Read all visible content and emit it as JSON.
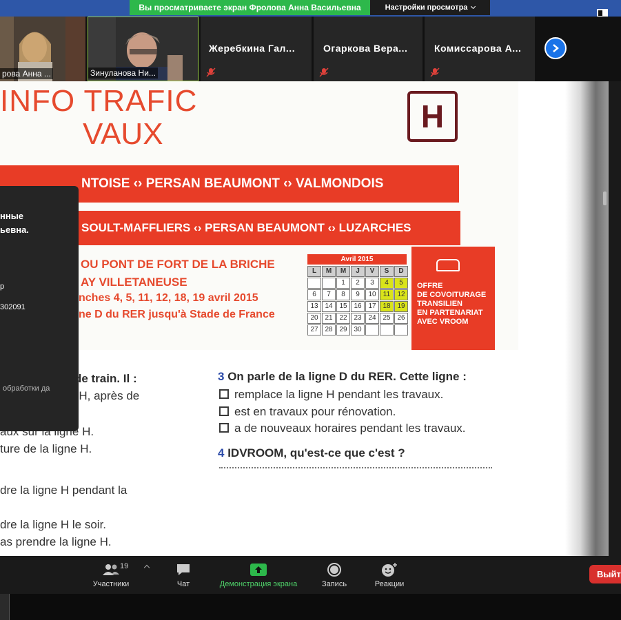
{
  "banner": {
    "sharing_text": "Вы просматриваете экран Фролова Анна Васильевна",
    "view_settings_label": "Настройки просмотра"
  },
  "participants": [
    {
      "label": "рова Анна ..."
    },
    {
      "label": "Зинуланова Ни..."
    },
    {
      "name": "Жеребкина  Гал..."
    },
    {
      "name": "Огаркова  Вера..."
    },
    {
      "name": "Комиссарова  А..."
    }
  ],
  "poster": {
    "title_line1": "INFO TRAFIC",
    "title_line2": "VAUX",
    "line_letter": "H",
    "band1": "NTOISE ‹› PERSAN BEAUMONT ‹› VALMONDOIS",
    "band2": "SOULT-MAFFLIERS ‹› PERSAN BEAUMONT ‹› LUZARCHES",
    "info1": "OU PONT DE FORT DE LA BRICHE",
    "info2": "AY VILLETANEUSE",
    "info3": "nches 4, 5, 11, 12, 18, 19 avril 2015",
    "info4": "ne D du RER jusqu'à Stade de France",
    "offer_lines": [
      "OFFRE",
      "DE COVOITURAGE",
      "TRANSILIEN",
      "EN PARTENARIAT",
      "AVEC  VROOM"
    ],
    "calendar": {
      "title": "Avril 2015",
      "headers": [
        "L",
        "M",
        "M",
        "J",
        "V",
        "S",
        "D"
      ],
      "rows": [
        [
          "",
          "",
          "1",
          "2",
          "3",
          "4",
          "5"
        ],
        [
          "6",
          "7",
          "8",
          "9",
          "10",
          "11",
          "12"
        ],
        [
          "13",
          "14",
          "15",
          "16",
          "17",
          "18",
          "19"
        ],
        [
          "20",
          "21",
          "22",
          "23",
          "24",
          "25",
          "26"
        ],
        [
          "27",
          "28",
          "29",
          "30",
          "",
          "",
          ""
        ]
      ],
      "highlighted_days": [
        "4",
        "5",
        "11",
        "12",
        "18",
        "19"
      ]
    }
  },
  "exercise": {
    "left": [
      "e d'une ligne de train. Il :",
      "tion de la ligne H, après de",
      "aux sur la ligne H.",
      "ture de la ligne H.",
      "dre la ligne H pendant la",
      "dre la ligne H le soir.",
      "as prendre la ligne H."
    ],
    "q3_num": "3",
    "q3": "On parle de la ligne D du RER. Cette ligne :",
    "options": [
      "remplace la ligne H pendant les travaux.",
      "est en travaux pour rénovation.",
      "a de nouveaux horaires pendant les travaux."
    ],
    "q4_num": "4",
    "q4": "IDVROOM, qu'est-ce que c'est ?"
  },
  "chat_panel": {
    "line1": "нные",
    "line2": "ьевна.",
    "line3": "р",
    "line4": "302091",
    "line5": "обработки да"
  },
  "toolbar": {
    "participants_label": "Участники",
    "participants_count": "19",
    "chat_label": "Чат",
    "share_label": "Демонстрация экрана",
    "record_label": "Запись",
    "reactions_label": "Реакции",
    "leave_label": "Выйти"
  },
  "colors": {
    "accent_red": "#e83c26",
    "share_green": "#2db84b",
    "leave_red": "#d8302d",
    "next_blue": "#1a73e8"
  }
}
